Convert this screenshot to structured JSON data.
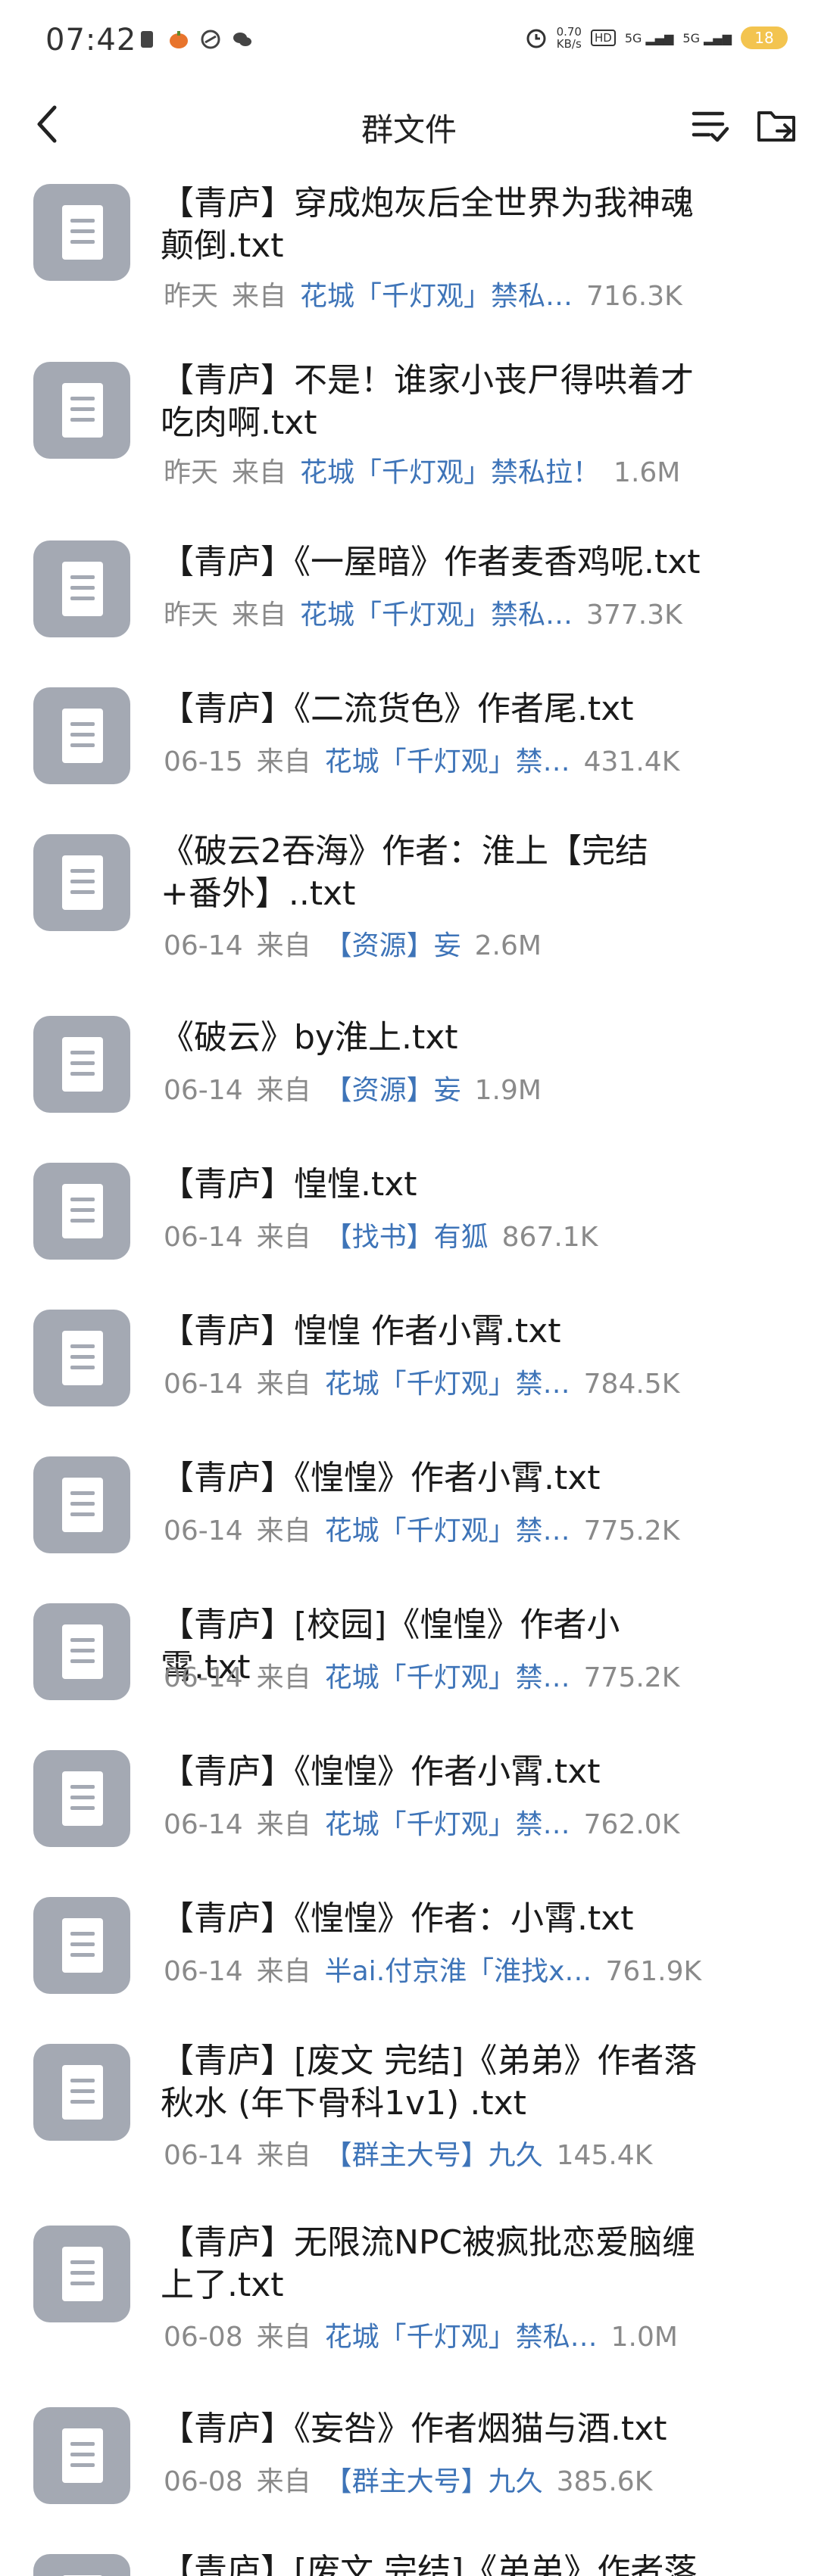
{
  "status_bar": {
    "time": "07:42",
    "net_speed_value": "0.70",
    "net_speed_unit": "KB/s",
    "hd_label": "HD",
    "signal1": "5G",
    "signal2": "5G",
    "battery": "18"
  },
  "nav": {
    "title": "群文件"
  },
  "files": [
    {
      "name": "【青庐】穿成炮灰后全世界为我神魂颠倒.txt",
      "date": "昨天",
      "from_label": "来自",
      "source": "花城「千灯观」禁私…",
      "size": "716.3K"
    },
    {
      "name": "【青庐】不是！谁家小丧尸得哄着才吃肉啊.txt",
      "date": "昨天",
      "from_label": "来自",
      "source": "花城「千灯观」禁私拉！",
      "size": "1.6M"
    },
    {
      "name": "【青庐】《一屋暗》作者麦香鸡呢.txt",
      "date": "昨天",
      "from_label": "来自",
      "source": "花城「千灯观」禁私…",
      "size": "377.3K"
    },
    {
      "name": "【青庐】《二流货色》作者尾.txt",
      "date": "06-15",
      "from_label": "来自",
      "source": "花城「千灯观」禁…",
      "size": "431.4K"
    },
    {
      "name": "《破云2吞海》作者：淮上【完结+番外】..txt",
      "date": "06-14",
      "from_label": "来自",
      "source": "【资源】妄",
      "size": "2.6M"
    },
    {
      "name": "《破云》by淮上.txt",
      "date": "06-14",
      "from_label": "来自",
      "source": "【资源】妄",
      "size": "1.9M"
    },
    {
      "name": "【青庐】惶惶.txt",
      "date": "06-14",
      "from_label": "来自",
      "source": "【找书】有狐",
      "size": "867.1K"
    },
    {
      "name": "【青庐】惶惶 作者小霄.txt",
      "date": "06-14",
      "from_label": "来自",
      "source": "花城「千灯观」禁…",
      "size": "784.5K"
    },
    {
      "name": "【青庐】《惶惶》作者小霄.txt",
      "date": "06-14",
      "from_label": "来自",
      "source": "花城「千灯观」禁…",
      "size": "775.2K"
    },
    {
      "name": "【青庐】[校园]《惶惶》作者小霄.txt",
      "date": "06-14",
      "from_label": "来自",
      "source": "花城「千灯观」禁…",
      "size": "775.2K"
    },
    {
      "name": "【青庐】《惶惶》作者小霄.txt",
      "date": "06-14",
      "from_label": "来自",
      "source": "花城「千灯观」禁…",
      "size": "762.0K"
    },
    {
      "name": "【青庐】《惶惶》作者：小霄.txt",
      "date": "06-14",
      "from_label": "来自",
      "source": "半ai.付京淮「淮找x…",
      "size": "761.9K"
    },
    {
      "name": "【青庐】[废文 完结]《弟弟》作者落秋水 (年下骨科1v1) .txt",
      "date": "06-14",
      "from_label": "来自",
      "source": "【群主大号】九久",
      "size": "145.4K"
    },
    {
      "name": "【青庐】无限流NPC被疯批恋爱脑缠上了.txt",
      "date": "06-08",
      "from_label": "来自",
      "source": "花城「千灯观」禁私…",
      "size": "1.0M"
    },
    {
      "name": "【青庐】《妄咎》作者烟猫与酒.txt",
      "date": "06-08",
      "from_label": "来自",
      "source": "【群主大号】九久",
      "size": "385.6K"
    },
    {
      "name": "【青庐】[废文 完结]《弟弟》作者落",
      "date": "",
      "from_label": "",
      "source": "",
      "size": ""
    }
  ]
}
